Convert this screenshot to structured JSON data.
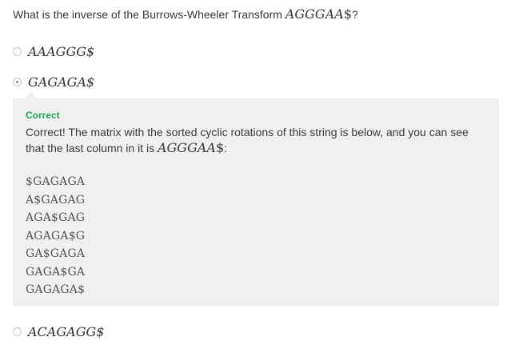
{
  "question": {
    "prefix": "What is the inverse of the Burrows-Wheeler Transform ",
    "math": "AGGGAA",
    "math_suffix": "$",
    "suffix": "?"
  },
  "options": [
    {
      "label": "AAAGGG$",
      "selected": false
    },
    {
      "label": "GAGAGA$",
      "selected": true
    },
    {
      "label": "ACAGAGG$",
      "selected": false
    }
  ],
  "feedback": {
    "status": "Correct",
    "text_prefix": "Correct! The matrix with the sorted cyclic rotations of this string is below, and you can see that the last column in it is ",
    "text_math": "AGGGAA",
    "text_math_suffix": "$",
    "text_suffix": ":",
    "rotations": [
      "$GAGAGA",
      "A$GAGAG",
      "AGA$GAG",
      "AGAGA$G",
      "GA$GAGA",
      "GAGA$GA",
      "GAGAGA$"
    ],
    "status_color": "#26a65b",
    "background": "#f0f0f0"
  }
}
